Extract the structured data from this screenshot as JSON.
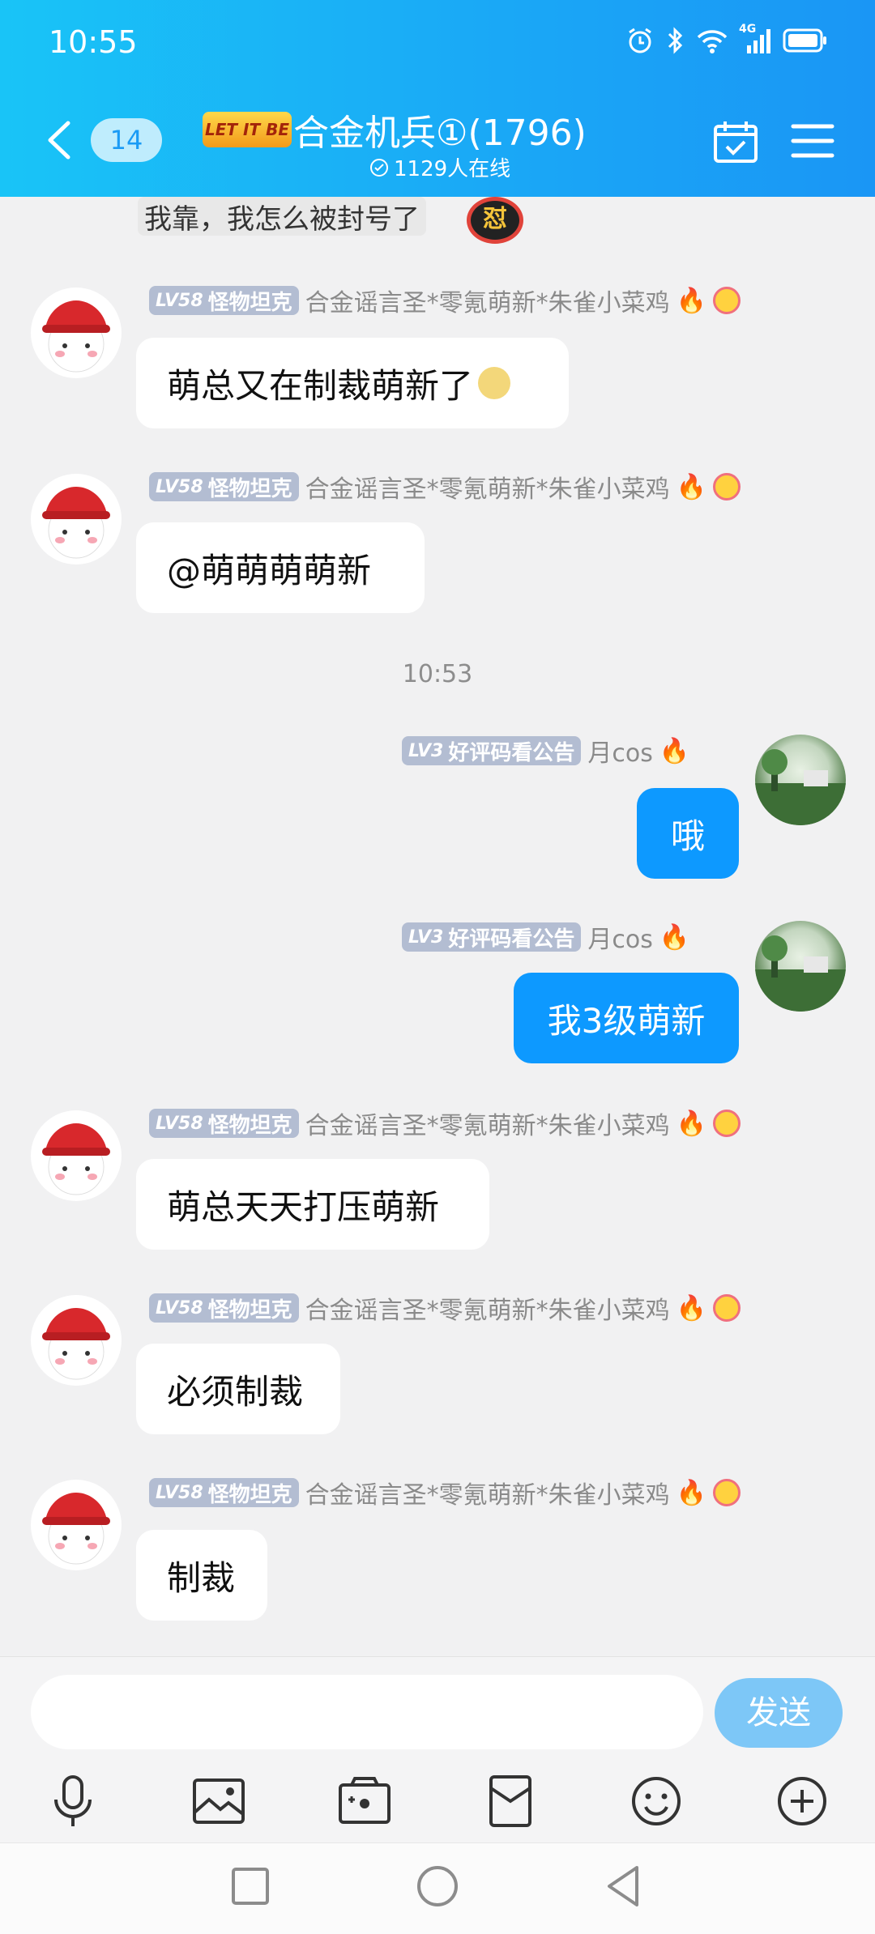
{
  "status_bar": {
    "time": "10:55",
    "network": "4G"
  },
  "header": {
    "unread_count": "14",
    "group_logo_text": "LET IT BE",
    "group_title": "合金机兵①(1796)",
    "online_text": "1129人在线"
  },
  "messages": {
    "partial_top": {
      "text": "我靠，我怎么被封号了",
      "badge": "怼"
    },
    "m1": {
      "level": "LV58",
      "title": "怪物坦克",
      "sender": "合金谣言圣*零氪萌新*朱雀小菜鸡",
      "text": "萌总又在制裁萌新了"
    },
    "m2": {
      "level": "LV58",
      "title": "怪物坦克",
      "sender": "合金谣言圣*零氪萌新*朱雀小菜鸡",
      "text": "@萌萌萌萌新"
    },
    "time_divider": "10:53",
    "m3": {
      "level": "LV3",
      "title": "好评码看公告",
      "sender": "月cos",
      "text": "哦"
    },
    "m4": {
      "level": "LV3",
      "title": "好评码看公告",
      "sender": "月cos",
      "text": "我3级萌新"
    },
    "m5": {
      "level": "LV58",
      "title": "怪物坦克",
      "sender": "合金谣言圣*零氪萌新*朱雀小菜鸡",
      "text": "萌总天天打压萌新"
    },
    "m6": {
      "level": "LV58",
      "title": "怪物坦克",
      "sender": "合金谣言圣*零氪萌新*朱雀小菜鸡",
      "text": "必须制裁"
    },
    "m7": {
      "level": "LV58",
      "title": "怪物坦克",
      "sender": "合金谣言圣*零氪萌新*朱雀小菜鸡",
      "text": "制裁"
    }
  },
  "input": {
    "placeholder": "",
    "send_label": "发送"
  },
  "toolbar_icons": [
    "microphone-icon",
    "image-icon",
    "camera-icon",
    "red-packet-icon",
    "emoji-icon",
    "plus-icon"
  ],
  "system_nav_icons": [
    "recent-apps-icon",
    "home-icon",
    "back-icon"
  ],
  "colors": {
    "header_start": "#19c4f7",
    "header_end": "#1a96f5",
    "outgoing_bubble": "#0d99ff",
    "send_button": "#7dc7f7",
    "level_badge": "#b3bdd2"
  }
}
